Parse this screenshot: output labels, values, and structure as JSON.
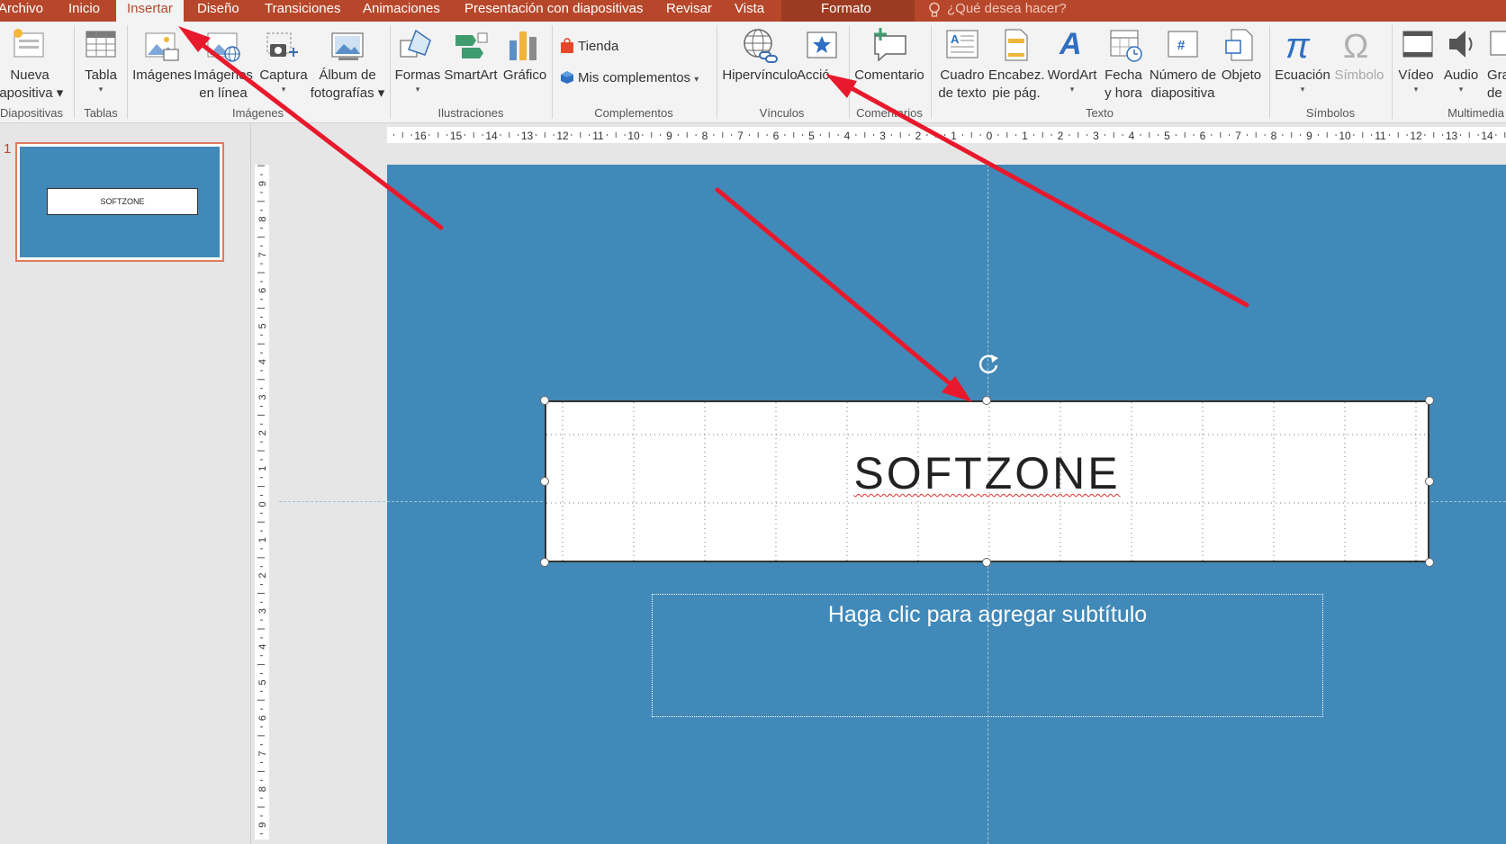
{
  "tabs": {
    "archivo": "Archivo",
    "inicio": "Inicio",
    "insertar": "Insertar",
    "diseno": "Diseño",
    "transiciones": "Transiciones",
    "animaciones": "Animaciones",
    "presentacion": "Presentación con diapositivas",
    "revisar": "Revisar",
    "vista": "Vista",
    "formato": "Formato",
    "tell_me": "¿Qué desea hacer?"
  },
  "ribbon": {
    "nueva_1": "Nueva",
    "nueva_2": "iapositiva",
    "tabla": "Tabla",
    "imagenes": "Imágenes",
    "imagenes_linea_1": "Imágenes",
    "imagenes_linea_2": "en línea",
    "captura": "Captura",
    "album_1": "Álbum de",
    "album_2": "fotografías",
    "formas": "Formas",
    "smartart": "SmartArt",
    "grafico": "Gráfico",
    "tienda": "Tienda",
    "mis_complementos": "Mis complementos",
    "hipervinculo": "Hipervínculo",
    "accion": "Acció",
    "comentario": "Comentario",
    "cuadro_1": "Cuadro",
    "cuadro_2": "de texto",
    "encabez_1": "Encabez.",
    "encabez_2": "pie pág.",
    "wordart": "WordArt",
    "fecha_1": "Fecha",
    "fecha_2": "y hora",
    "numero_1": "Número de",
    "numero_2": "diapositiva",
    "objeto": "Objeto",
    "ecuacion": "Ecuación",
    "simbolo": "Símbolo",
    "video": "Vídeo",
    "audio": "Audio",
    "gra_1": "Gra",
    "gra_2": "de p",
    "groups": {
      "diapositivas": "Diapositivas",
      "tablas": "Tablas",
      "imagenes": "Imágenes",
      "ilustraciones": "Ilustraciones",
      "complementos": "Complementos",
      "vinculos": "Vínculos",
      "comentarios": "Comentarios",
      "texto": "Texto",
      "simbolos": "Símbolos",
      "multimedia": "Multimedia"
    }
  },
  "thumbnail": {
    "number": "1",
    "title": "SOFTZONE"
  },
  "rulers": {
    "horizontal": [
      "16",
      "15",
      "14",
      "13",
      "12",
      "11",
      "10",
      "9",
      "8",
      "7",
      "6",
      "5",
      "4",
      "3",
      "2",
      "1",
      "0",
      "1",
      "2",
      "3",
      "4",
      "5",
      "6",
      "7",
      "8",
      "9",
      "10",
      "11",
      "12",
      "13",
      "14"
    ],
    "vertical": [
      "9",
      "8",
      "7",
      "6",
      "5",
      "4",
      "3",
      "2",
      "1",
      "0",
      "1",
      "2",
      "3",
      "4",
      "5",
      "6",
      "7",
      "8",
      "9"
    ]
  },
  "slide": {
    "title": "SOFTZONE",
    "subtitle_placeholder": "Haga clic para agregar subtítulo"
  },
  "colors": {
    "accent": "#b7472a",
    "slide_bg": "#4189b8",
    "arrow": "#e8192c"
  }
}
